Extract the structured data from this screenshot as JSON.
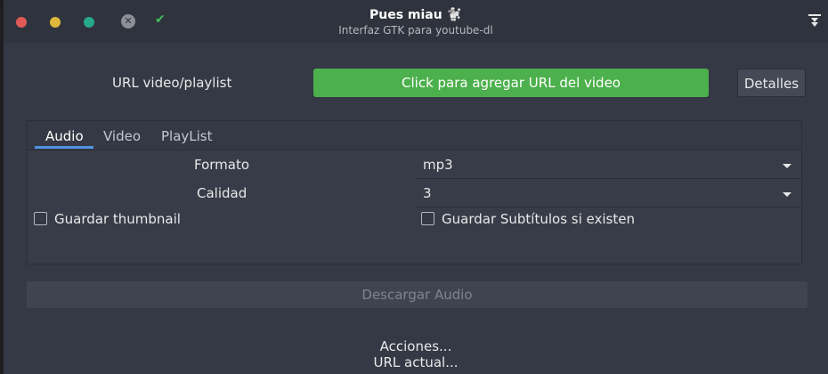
{
  "window": {
    "title": "Pues miau 🐩",
    "subtitle": "Interfaz GTK para youtube-dl"
  },
  "url_row": {
    "label": "URL video/playlist",
    "add_button": "Click para agregar URL del video",
    "details_button": "Detalles"
  },
  "tabs": [
    {
      "label": "Audio",
      "active": true
    },
    {
      "label": "Video",
      "active": false
    },
    {
      "label": "PlayList",
      "active": false
    }
  ],
  "audio": {
    "format_label": "Formato",
    "format_value": "mp3",
    "quality_label": "Calidad",
    "quality_value": "3",
    "thumbnail_label": "Guardar thumbnail",
    "thumbnail_checked": false,
    "subtitles_label": "Guardar Subtítulos si existen",
    "subtitles_checked": false
  },
  "download_button": "Descargar Audio",
  "status": {
    "actions": "Acciones...",
    "current_url": "URL actual..."
  },
  "icons": {
    "close": "close-icon",
    "minimize": "minimize-icon",
    "maximize": "maximize-icon",
    "tools": "tools-icon",
    "check": "check-icon",
    "download": "download-icon"
  },
  "colors": {
    "accent_green": "#4cb04c",
    "tab_underline": "#5294e2",
    "window_bg": "#353945"
  }
}
